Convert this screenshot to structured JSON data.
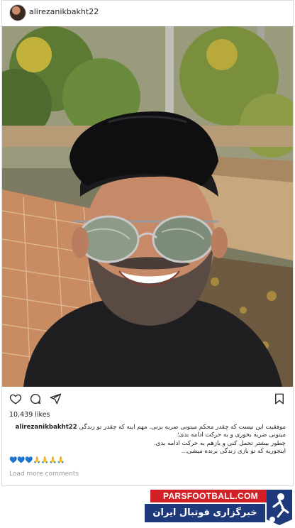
{
  "post": {
    "username": "alirezanikbakht22",
    "likes": "10,439 likes",
    "caption_lines": [
      "موفقیت این نیست که چقدر محکم میتونی ضربه بزنی. مهم اینه که چقدر تو زندگی",
      "میتونی ضربه بخوری و به حرکت ادامه بدی؛",
      "چطور بیشتر تحمل کنی و بازهم به حرکت ادامه بدی.",
      "اینجوریه که تو بازی زندگی برنده میشی..."
    ],
    "emojis": "💙💙💙🙏🙏🙏🙏",
    "load_more": "Load more comments"
  },
  "icons": {
    "like": "heart-icon",
    "comment": "comment-icon",
    "share": "send-icon",
    "save": "bookmark-icon"
  },
  "watermark": {
    "site": "PARSFOOTBALL.COM",
    "title": "خبرگزاری فوتبال ایران"
  },
  "colors": {
    "brand_red": "#d32027",
    "brand_blue": "#1e3a7b",
    "muted": "#999999"
  }
}
